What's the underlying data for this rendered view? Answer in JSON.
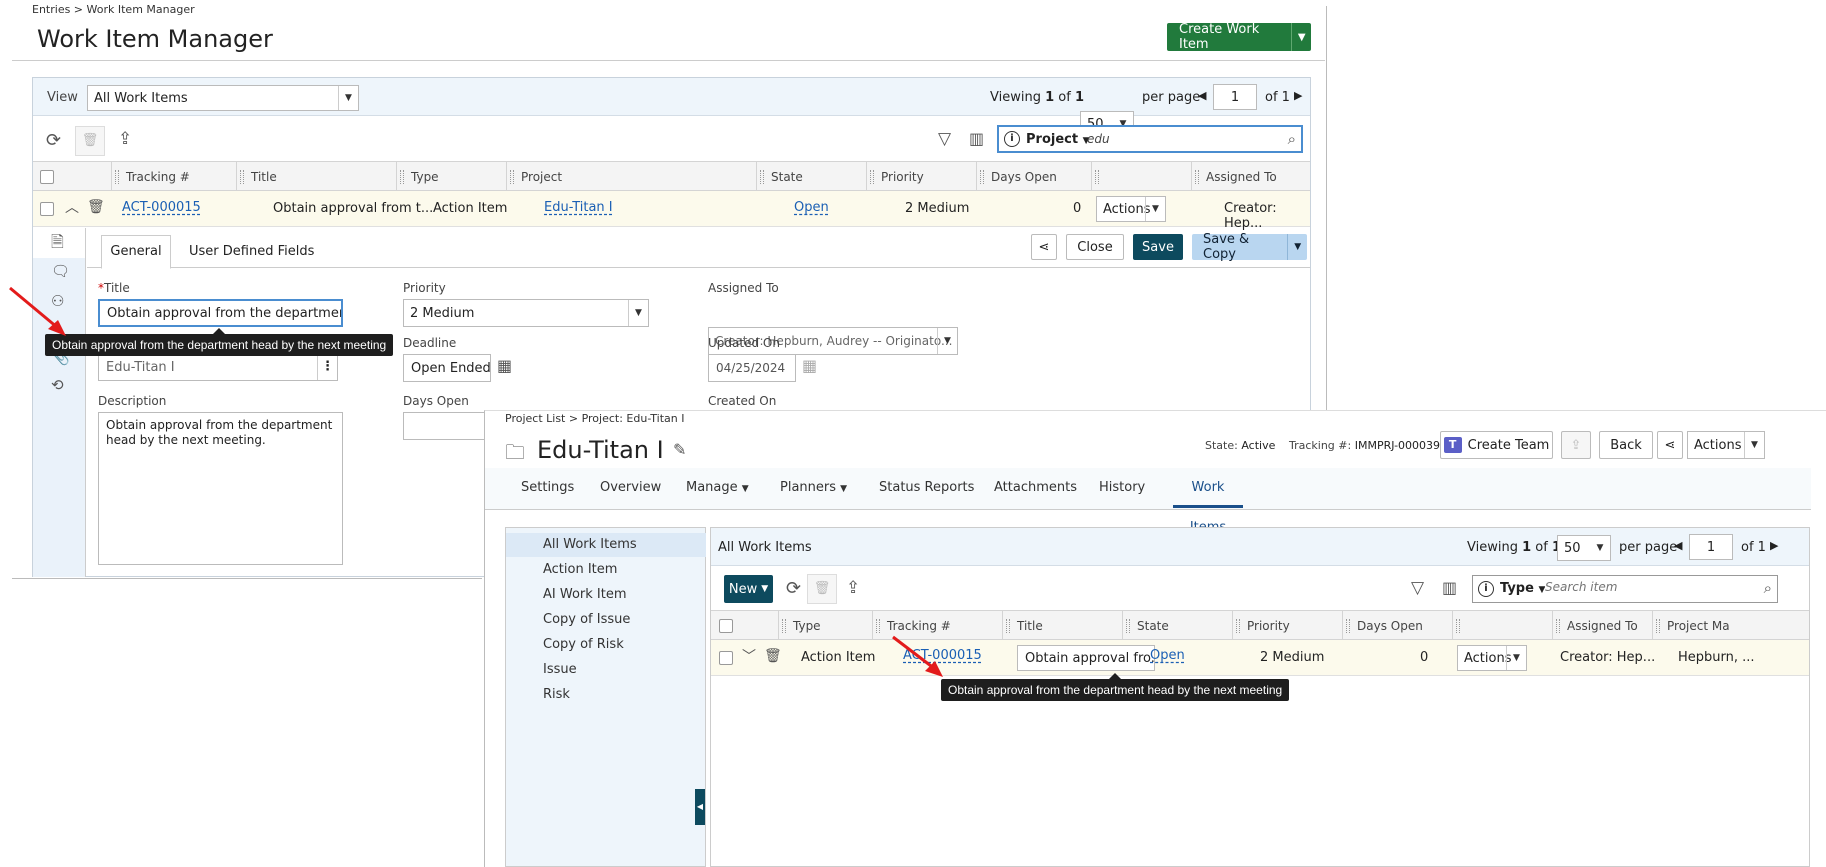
{
  "win1": {
    "breadcrumb": "Entries > Work Item Manager",
    "title": "Work Item Manager",
    "create_button": "Create Work Item",
    "view_label": "View",
    "view_value": "All Work Items",
    "viewing_prefix": "Viewing",
    "viewing_page": "1",
    "viewing_of": "of",
    "viewing_total": "1",
    "page_size": "50",
    "per_page": "per page",
    "page_input": "1",
    "of_pages": "of 1",
    "search_field": "Project",
    "search_value": "edu",
    "columns": [
      "Tracking #",
      "Title",
      "Type",
      "Project",
      "State",
      "Priority",
      "Days Open",
      "",
      "Assigned To"
    ],
    "row": {
      "tracking": "ACT-000015",
      "title": "Obtain approval from t...",
      "type": "Action Item",
      "project": "Edu-Titan I",
      "state": "Open",
      "priority": "2 Medium",
      "days_open": "0",
      "actions": "Actions",
      "assigned": "Creator: Hep..."
    },
    "detail": {
      "tab_general": "General",
      "tab_udf": "User Defined Fields",
      "close": "Close",
      "save": "Save",
      "save_copy": "Save & Copy",
      "title_required": "*",
      "title_label": "Title",
      "title_value": "Obtain approval from the department he",
      "priority_label": "Priority",
      "priority_value": "2 Medium",
      "assigned_label": "Assigned To",
      "assigned_value": "Creator: Hepburn, Audrey -- Originato...",
      "tooltip": "Obtain approval from the department head by the next meeting",
      "project_value": "Edu-Titan I",
      "deadline_label": "Deadline",
      "deadline_value": "Open Ended",
      "updated_label": "Updated On",
      "updated_value": "04/25/2024",
      "description_label": "Description",
      "description_value": "Obtain approval from the department head by the next meeting.",
      "days_open_label": "Days Open",
      "created_label": "Created On"
    }
  },
  "win2": {
    "breadcrumb": "Project List > Project: Edu-Titan I",
    "title": "Edu-Titan I",
    "state_label": "State:",
    "state_value": "Active",
    "tracking_label": "Tracking #:",
    "tracking_value": "IMMPRJ-000039",
    "create_team": "Create Team",
    "back": "Back",
    "actions": "Actions",
    "tabs": [
      "Settings",
      "Overview",
      "Manage",
      "Planners",
      "Status Reports",
      "Attachments",
      "History",
      "Work Items"
    ],
    "nav": [
      "All Work Items",
      "Action Item",
      "AI Work Item",
      "Copy of Issue",
      "Copy of Risk",
      "Issue",
      "Risk"
    ],
    "grid_title": "All Work Items",
    "viewing_prefix": "Viewing",
    "viewing_page": "1",
    "viewing_of": "of",
    "viewing_total": "1",
    "page_size": "50",
    "per_page": "per page",
    "page_input": "1",
    "of_pages": "of 1",
    "new_button": "New",
    "search_field": "Type",
    "search_placeholder": "Search item",
    "columns": [
      "Type",
      "Tracking #",
      "Title",
      "State",
      "Priority",
      "Days Open",
      "",
      "Assigned To",
      "Project Ma"
    ],
    "row": {
      "type": "Action Item",
      "tracking": "ACT-000015",
      "title": "Obtain approval fro...",
      "state": "Open",
      "priority": "2 Medium",
      "days_open": "0",
      "actions": "Actions",
      "assigned": "Creator: Hep...",
      "project_manager": "Hepburn, ..."
    },
    "tooltip": "Obtain approval from the department head by the next meeting"
  },
  "colors": {
    "green": "#217a3c",
    "dark_teal": "#0d4a5e",
    "link": "#1a5fb4",
    "arrow": "#e31b1b"
  }
}
